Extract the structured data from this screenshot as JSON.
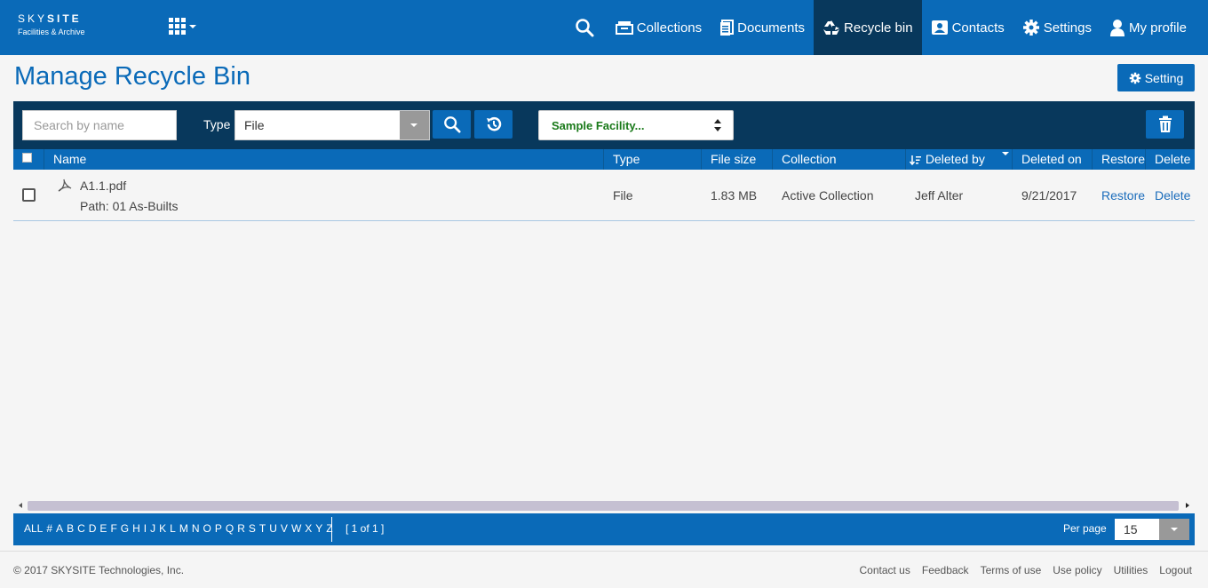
{
  "brand": {
    "name_light": "SKY",
    "name_bold": "SITE",
    "subtitle": "Facilities & Archive"
  },
  "nav": {
    "collections": "Collections",
    "documents": "Documents",
    "recycle_bin": "Recycle bin",
    "contacts": "Contacts",
    "settings": "Settings",
    "my_profile": "My profile"
  },
  "page": {
    "title": "Manage Recycle Bin",
    "setting_button": "Setting"
  },
  "toolbar": {
    "search_placeholder": "Search by name",
    "type_label": "Type",
    "type_value": "File",
    "facility_value": "Sample Facility..."
  },
  "table": {
    "columns": [
      "Name",
      "Type",
      "File size",
      "Collection",
      "Deleted by",
      "Deleted on",
      "Restore",
      "Delete"
    ],
    "rows": [
      {
        "name": "A1.1.pdf",
        "path": "Path: 01 As-Builts",
        "type": "File",
        "file_size": "1.83 MB",
        "collection": "Active Collection",
        "deleted_by": "Jeff Alter",
        "deleted_on": "9/21/2017",
        "restore": "Restore",
        "delete": "Delete"
      }
    ]
  },
  "pager": {
    "letters": [
      "ALL",
      "#",
      "A",
      "B",
      "C",
      "D",
      "E",
      "F",
      "G",
      "H",
      "I",
      "J",
      "K",
      "L",
      "M",
      "N",
      "O",
      "P",
      "Q",
      "R",
      "S",
      "T",
      "U",
      "V",
      "W",
      "X",
      "Y",
      "Z"
    ],
    "page_info": "[ 1 of 1 ]",
    "per_page_label": "Per page",
    "per_page_value": "15"
  },
  "footer": {
    "copyright": "© 2017 SKYSITE Technologies, Inc.",
    "links": [
      "Contact us",
      "Feedback",
      "Terms of use",
      "Use policy",
      "Utilities",
      "Logout"
    ]
  },
  "colors": {
    "primary": "#0a6ab8",
    "dark": "#08385c",
    "facility_text": "#1a7a1a"
  },
  "icons": [
    "search-icon",
    "collections-icon",
    "documents-icon",
    "recycle-icon",
    "contacts-icon",
    "gear-icon",
    "user-icon",
    "apps-grid-icon",
    "history-icon",
    "trash-icon",
    "pdf-icon",
    "sort-icon"
  ]
}
